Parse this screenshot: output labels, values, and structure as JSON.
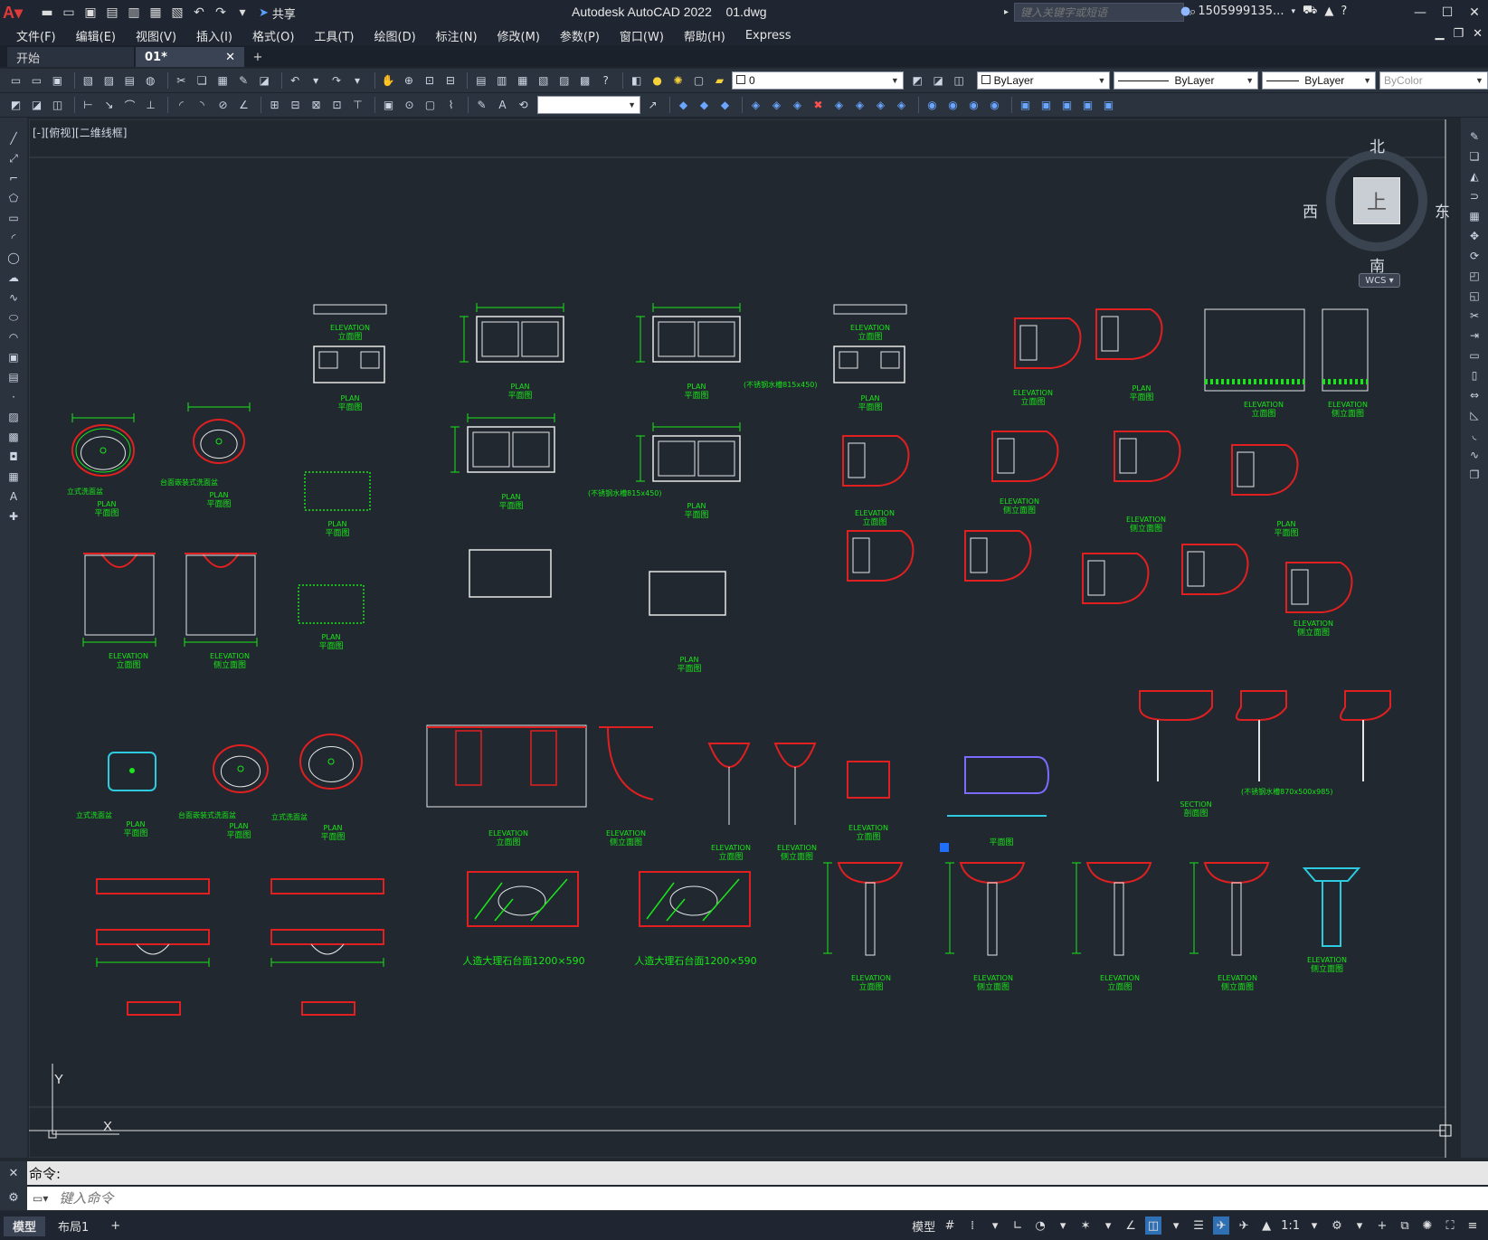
{
  "titlebar": {
    "app_title": "Autodesk AutoCAD 2022",
    "file_name": "01.dwg",
    "share_label": "共享",
    "search_placeholder": "键入关键字或短语",
    "user_name": "1505999135..."
  },
  "menu": [
    "文件(F)",
    "编辑(E)",
    "视图(V)",
    "插入(I)",
    "格式(O)",
    "工具(T)",
    "绘图(D)",
    "标注(N)",
    "修改(M)",
    "参数(P)",
    "窗口(W)",
    "帮助(H)",
    "Express"
  ],
  "tabs": [
    {
      "label": "开始"
    },
    {
      "label": "01*"
    }
  ],
  "properties": {
    "layer_value": "0",
    "color_value": "ByLayer",
    "linetype_value": "ByLayer",
    "lineweight_value": "ByLayer",
    "plotstyle_value": "ByColor"
  },
  "viewport": {
    "label": "[-][俯视][二维线框]",
    "viewcube": {
      "top": "上",
      "north": "北",
      "south": "南",
      "east": "东",
      "west": "西"
    },
    "wcs_label": "WCS"
  },
  "drawing": {
    "ucs_x": "X",
    "ucs_y": "Y",
    "labels": [
      {
        "t": "ELEVATION"
      },
      {
        "t": "立面图"
      },
      {
        "t": "PLAN"
      },
      {
        "t": "平面图"
      },
      {
        "t": "侧立面图"
      },
      {
        "t": "SECTION"
      },
      {
        "t": "剖面图"
      },
      {
        "t": "立式洗面盆"
      },
      {
        "t": "台面嵌装式洗面盆"
      },
      {
        "t": "(不锈钢水槽815x450)"
      },
      {
        "t": "(不锈钢水槽870x500x985)"
      },
      {
        "t": "人造大理石台面1200×590"
      }
    ]
  },
  "command": {
    "history": "命令:",
    "placeholder": "键入命令"
  },
  "status": {
    "layout_tabs": [
      "模型",
      "布局1"
    ],
    "model_label": "模型",
    "scale": "1:1"
  },
  "colors": {
    "canvas": "#212830",
    "chrome": "#1f2631",
    "toolbar": "#2b333f",
    "red": "#e02020",
    "green": "#19e619",
    "cyan": "#2ecbe0"
  }
}
